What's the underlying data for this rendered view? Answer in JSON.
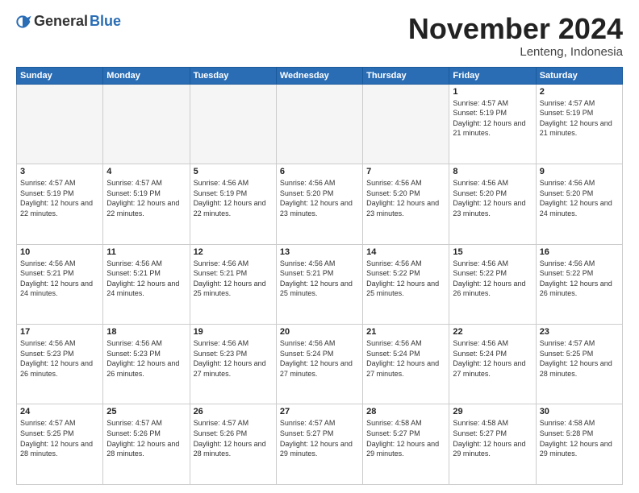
{
  "logo": {
    "general": "General",
    "blue": "Blue"
  },
  "title": {
    "month": "November 2024",
    "location": "Lenteng, Indonesia"
  },
  "days_of_week": [
    "Sunday",
    "Monday",
    "Tuesday",
    "Wednesday",
    "Thursday",
    "Friday",
    "Saturday"
  ],
  "weeks": [
    [
      {
        "day": "",
        "empty": true
      },
      {
        "day": "",
        "empty": true
      },
      {
        "day": "",
        "empty": true
      },
      {
        "day": "",
        "empty": true
      },
      {
        "day": "",
        "empty": true
      },
      {
        "day": "1",
        "sunrise": "4:57 AM",
        "sunset": "5:19 PM",
        "daylight": "12 hours and 21 minutes."
      },
      {
        "day": "2",
        "sunrise": "4:57 AM",
        "sunset": "5:19 PM",
        "daylight": "12 hours and 21 minutes."
      }
    ],
    [
      {
        "day": "3",
        "sunrise": "4:57 AM",
        "sunset": "5:19 PM",
        "daylight": "12 hours and 22 minutes."
      },
      {
        "day": "4",
        "sunrise": "4:57 AM",
        "sunset": "5:19 PM",
        "daylight": "12 hours and 22 minutes."
      },
      {
        "day": "5",
        "sunrise": "4:56 AM",
        "sunset": "5:19 PM",
        "daylight": "12 hours and 22 minutes."
      },
      {
        "day": "6",
        "sunrise": "4:56 AM",
        "sunset": "5:20 PM",
        "daylight": "12 hours and 23 minutes."
      },
      {
        "day": "7",
        "sunrise": "4:56 AM",
        "sunset": "5:20 PM",
        "daylight": "12 hours and 23 minutes."
      },
      {
        "day": "8",
        "sunrise": "4:56 AM",
        "sunset": "5:20 PM",
        "daylight": "12 hours and 23 minutes."
      },
      {
        "day": "9",
        "sunrise": "4:56 AM",
        "sunset": "5:20 PM",
        "daylight": "12 hours and 24 minutes."
      }
    ],
    [
      {
        "day": "10",
        "sunrise": "4:56 AM",
        "sunset": "5:21 PM",
        "daylight": "12 hours and 24 minutes."
      },
      {
        "day": "11",
        "sunrise": "4:56 AM",
        "sunset": "5:21 PM",
        "daylight": "12 hours and 24 minutes."
      },
      {
        "day": "12",
        "sunrise": "4:56 AM",
        "sunset": "5:21 PM",
        "daylight": "12 hours and 25 minutes."
      },
      {
        "day": "13",
        "sunrise": "4:56 AM",
        "sunset": "5:21 PM",
        "daylight": "12 hours and 25 minutes."
      },
      {
        "day": "14",
        "sunrise": "4:56 AM",
        "sunset": "5:22 PM",
        "daylight": "12 hours and 25 minutes."
      },
      {
        "day": "15",
        "sunrise": "4:56 AM",
        "sunset": "5:22 PM",
        "daylight": "12 hours and 26 minutes."
      },
      {
        "day": "16",
        "sunrise": "4:56 AM",
        "sunset": "5:22 PM",
        "daylight": "12 hours and 26 minutes."
      }
    ],
    [
      {
        "day": "17",
        "sunrise": "4:56 AM",
        "sunset": "5:23 PM",
        "daylight": "12 hours and 26 minutes."
      },
      {
        "day": "18",
        "sunrise": "4:56 AM",
        "sunset": "5:23 PM",
        "daylight": "12 hours and 26 minutes."
      },
      {
        "day": "19",
        "sunrise": "4:56 AM",
        "sunset": "5:23 PM",
        "daylight": "12 hours and 27 minutes."
      },
      {
        "day": "20",
        "sunrise": "4:56 AM",
        "sunset": "5:24 PM",
        "daylight": "12 hours and 27 minutes."
      },
      {
        "day": "21",
        "sunrise": "4:56 AM",
        "sunset": "5:24 PM",
        "daylight": "12 hours and 27 minutes."
      },
      {
        "day": "22",
        "sunrise": "4:56 AM",
        "sunset": "5:24 PM",
        "daylight": "12 hours and 27 minutes."
      },
      {
        "day": "23",
        "sunrise": "4:57 AM",
        "sunset": "5:25 PM",
        "daylight": "12 hours and 28 minutes."
      }
    ],
    [
      {
        "day": "24",
        "sunrise": "4:57 AM",
        "sunset": "5:25 PM",
        "daylight": "12 hours and 28 minutes."
      },
      {
        "day": "25",
        "sunrise": "4:57 AM",
        "sunset": "5:26 PM",
        "daylight": "12 hours and 28 minutes."
      },
      {
        "day": "26",
        "sunrise": "4:57 AM",
        "sunset": "5:26 PM",
        "daylight": "12 hours and 28 minutes."
      },
      {
        "day": "27",
        "sunrise": "4:57 AM",
        "sunset": "5:27 PM",
        "daylight": "12 hours and 29 minutes."
      },
      {
        "day": "28",
        "sunrise": "4:58 AM",
        "sunset": "5:27 PM",
        "daylight": "12 hours and 29 minutes."
      },
      {
        "day": "29",
        "sunrise": "4:58 AM",
        "sunset": "5:27 PM",
        "daylight": "12 hours and 29 minutes."
      },
      {
        "day": "30",
        "sunrise": "4:58 AM",
        "sunset": "5:28 PM",
        "daylight": "12 hours and 29 minutes."
      }
    ]
  ]
}
